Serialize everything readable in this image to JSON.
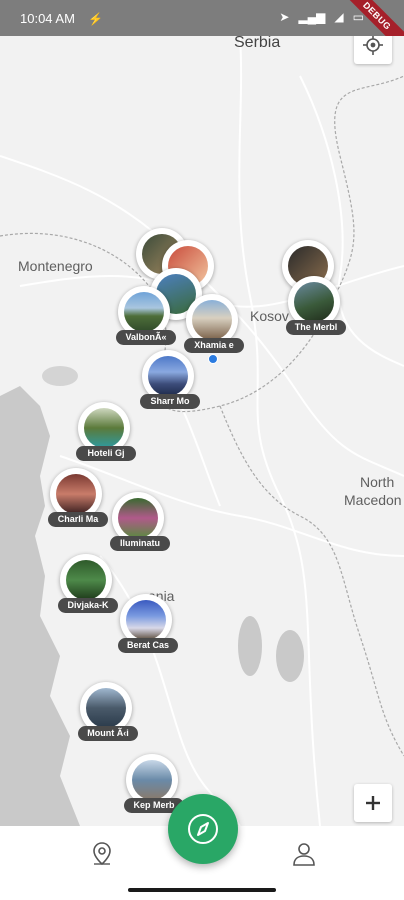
{
  "status_bar": {
    "time": "10:04 AM",
    "debug_label": "DEBUG"
  },
  "map": {
    "labels": {
      "serbia": "Serbia",
      "montenegro": "Montenegro",
      "kosovo": "Kosov",
      "north": "North",
      "macedonia": "Macedon",
      "albania": "ania"
    }
  },
  "places": [
    {
      "label": "ValbonÃ«"
    },
    {
      "label": "Xhamia e"
    },
    {
      "label": "The Merbl"
    },
    {
      "label": "Sharr Mo"
    },
    {
      "label": "Hoteli Gj"
    },
    {
      "label": "Charli Ma"
    },
    {
      "label": "Iluminatu"
    },
    {
      "label": "Divjaka-K"
    },
    {
      "label": "Berat Cas"
    },
    {
      "label": "Mount Ã‹i"
    },
    {
      "label": "Kep Merb"
    }
  ],
  "colors": {
    "fab": "#29a766",
    "location_dot": "#2b7be0",
    "tag_bg": "#4a4a4a"
  },
  "bottom_nav": {
    "left_icon": "map-pin-icon",
    "center_icon": "compass-icon",
    "right_icon": "profile-icon"
  }
}
